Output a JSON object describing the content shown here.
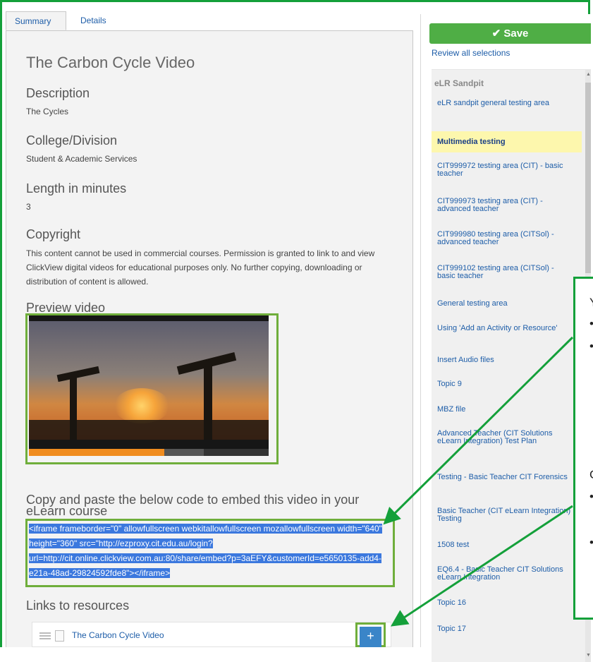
{
  "tabs": {
    "summary": "Summary",
    "details": "Details"
  },
  "content": {
    "title": "The Carbon Cycle Video",
    "description_label": "Description",
    "description": "The Cycles",
    "college_label": "College/Division",
    "college": "Student & Academic Services",
    "length_label": "Length in minutes",
    "length": "3",
    "copyright_label": "Copyright",
    "copyright": "This content cannot be used in commercial courses. Permission is granted to link to and view ClickView digital videos for educational purposes only. No further copying, downloading or distribution of content is allowed.",
    "preview_label": "Preview video",
    "embed_label": "Copy and paste the below code to embed this video in your eLearn course",
    "embed_code": "<iframe frameborder=\"0\" allowfullscreen webkitallowfullscreen mozallowfullscreen width=\"640\" height=\"360\" src=\"http://ezproxy.cit.edu.au/login?url=http://cit.online.clickview.com.au:80/share/embed?p=3aEFY&customerId=e5650135-add4-e21a-48ad-29824592fde8\"></iframe>",
    "links_label": "Links to resources",
    "resource_title": "The Carbon Cycle Video",
    "add_glyph": "+"
  },
  "sidebar": {
    "save": "✔ Save",
    "review": "Review all selections",
    "group": "eLR Sandpit",
    "items": [
      "eLR sandpit general testing area",
      "Multimedia testing",
      "CIT999972 testing area (CIT) - basic teacher",
      "CIT999973 testing area (CIT) - advanced teacher",
      "CIT999980 testing area (CITSol) - advanced teacher",
      "CIT999102 testing area (CITSol) - basic teacher",
      "General testing area",
      "Using 'Add an Activity or Resource'",
      "Insert Audio files",
      "Topic 9",
      "MBZ file",
      "Advanced Teacher (CIT Solutions eLearn Integration) Test Plan",
      "Testing - Basic Teacher CIT Forensics",
      "Basic Teacher (CIT eLearn Integration) Testing",
      "1508 test",
      "EQ6.4 - Basic Teacher CIT Solutions eLearn Integration",
      "Topic 16",
      "Topic 17"
    ],
    "selected": "Multimedia testing"
  },
  "callout": {
    "line1": "Y",
    "bullet": "•",
    "line2": "C"
  },
  "colors": {
    "accent_green": "#14a03a",
    "highlight": "#fdf7ad",
    "selection_blue": "#3b78de",
    "save_green": "#4fae45"
  }
}
